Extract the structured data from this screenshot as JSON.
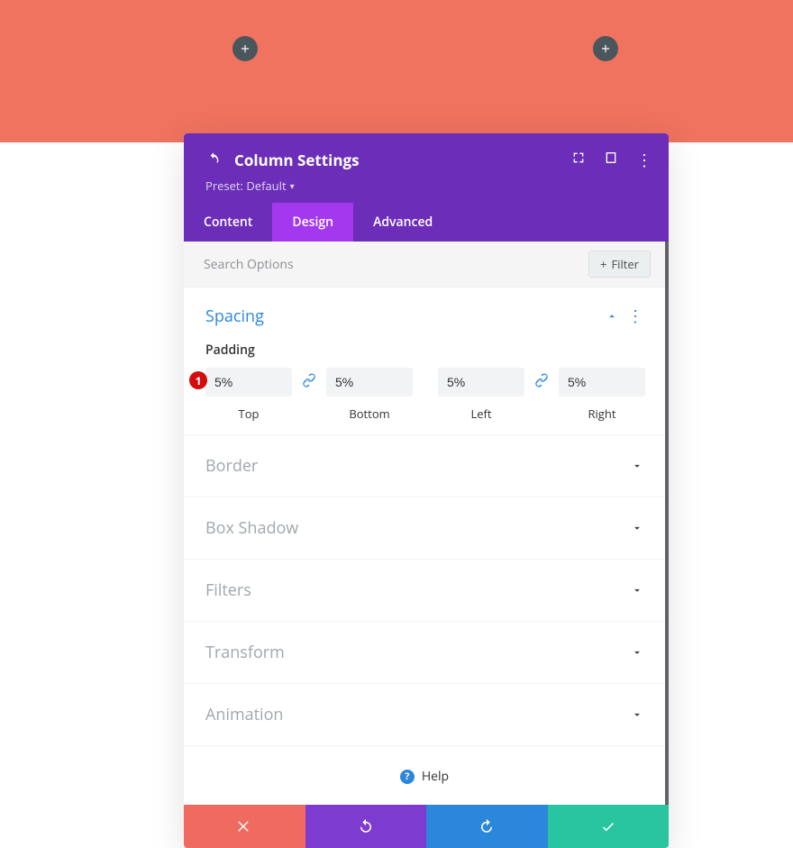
{
  "canvas": {
    "add_button_label": "+"
  },
  "modal": {
    "title": "Column Settings",
    "preset_label": "Preset: Default",
    "tabs": {
      "content": "Content",
      "design": "Design",
      "advanced": "Advanced",
      "active": "design"
    },
    "search": {
      "placeholder": "Search Options",
      "filter_label": "Filter"
    },
    "sections": {
      "spacing": {
        "title": "Spacing",
        "padding_label": "Padding",
        "marker": "1",
        "padding": {
          "top": {
            "value": "5%",
            "label": "Top"
          },
          "bottom": {
            "value": "5%",
            "label": "Bottom"
          },
          "left": {
            "value": "5%",
            "label": "Left"
          },
          "right": {
            "value": "5%",
            "label": "Right"
          }
        }
      },
      "border": {
        "title": "Border"
      },
      "box_shadow": {
        "title": "Box Shadow"
      },
      "filters": {
        "title": "Filters"
      },
      "transform": {
        "title": "Transform"
      },
      "animation": {
        "title": "Animation"
      }
    },
    "help_label": "Help"
  }
}
